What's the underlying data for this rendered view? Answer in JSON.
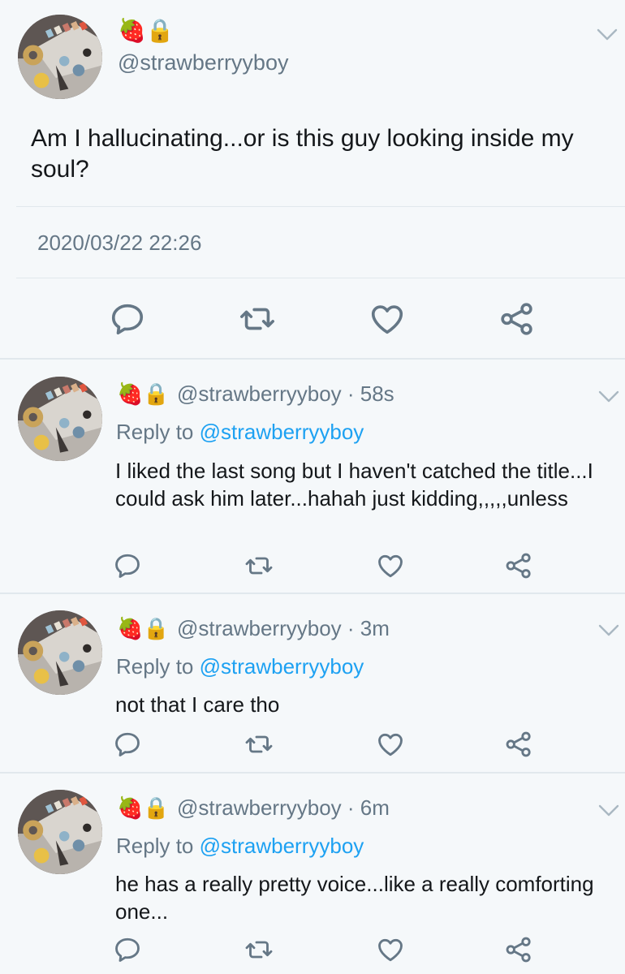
{
  "main_tweet": {
    "emojis": "🍓🔒",
    "handle": "@strawberryyboy",
    "text": "Am I hallucinating...or is this guy looking inside my soul?",
    "timestamp": "2020/03/22 22:26",
    "actions": [
      "reply-icon",
      "retweet-icon",
      "like-icon",
      "share-icon"
    ]
  },
  "replies": [
    {
      "emojis": "🍓🔒",
      "handle": "@strawberryyboy",
      "time": " · 58s",
      "reply_prefix": "Reply to ",
      "reply_to": "@strawberryyboy",
      "text": "I liked the last song but I haven't catched the title...I could ask him later...hahah just kidding,,,,,unless"
    },
    {
      "emojis": "🍓🔒",
      "handle": "@strawberryyboy",
      "time": " · 3m",
      "reply_prefix": "Reply to ",
      "reply_to": "@strawberryyboy",
      "text": "not that I care tho"
    },
    {
      "emojis": "🍓🔒",
      "handle": "@strawberryyboy",
      "time": " · 6m",
      "reply_prefix": "Reply to ",
      "reply_to": "@strawberryyboy",
      "text": "he has a really pretty voice...like a really comforting one..."
    }
  ],
  "colors": {
    "background": "#f5f8fa",
    "text": "#14171a",
    "secondary": "#657786",
    "link": "#1da1f2",
    "icon": "#657786"
  }
}
